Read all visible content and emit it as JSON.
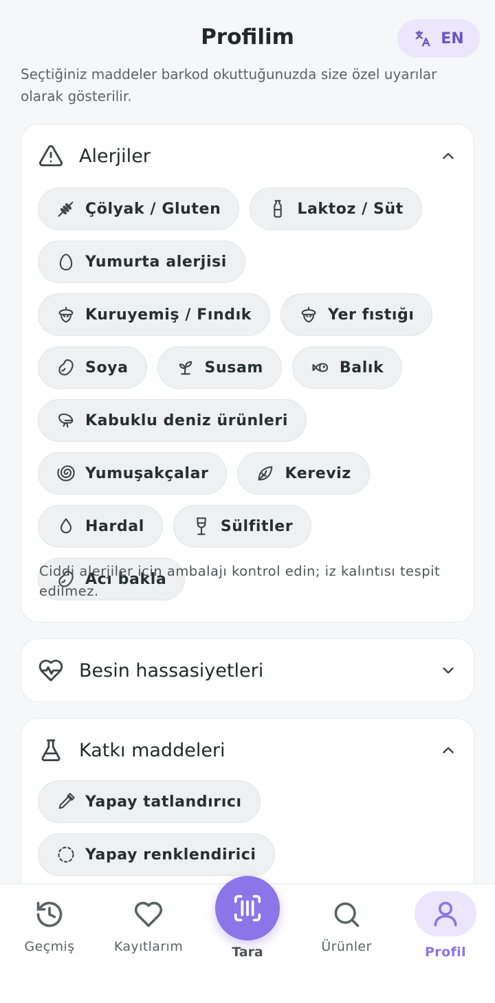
{
  "header": {
    "title": "Profilim",
    "language": "EN"
  },
  "intro_text": "Seçtiğiniz maddeler barkod okuttuğunuzda size özel uyarılar olarak gösterilir.",
  "sections": {
    "allergies": {
      "title": "Alerjiler",
      "expanded": true,
      "chips": [
        {
          "label": "Çölyak / Gluten",
          "icon": "wheat-icon"
        },
        {
          "label": "Laktoz / Süt",
          "icon": "milk-bottle-icon"
        },
        {
          "label": "Yumurta alerjisi",
          "icon": "egg-icon"
        },
        {
          "label": "Kuruyemiş / Fındık",
          "icon": "nut-icon"
        },
        {
          "label": "Yer fıstığı",
          "icon": "nut-icon"
        },
        {
          "label": "Soya",
          "icon": "bean-icon"
        },
        {
          "label": "Susam",
          "icon": "sprout-icon"
        },
        {
          "label": "Balık",
          "icon": "fish-icon"
        },
        {
          "label": "Kabuklu deniz ürünleri",
          "icon": "shrimp-icon"
        },
        {
          "label": "Yumuşakçalar",
          "icon": "shell-icon"
        },
        {
          "label": "Kereviz",
          "icon": "leaf-icon"
        },
        {
          "label": "Hardal",
          "icon": "droplet-icon"
        },
        {
          "label": "Sülfitler",
          "icon": "wine-glass-icon"
        },
        {
          "label": "Acı bakla",
          "icon": "bean-icon"
        }
      ],
      "note": "Ciddi alerjiler için ambalajı kontrol edin; iz kalıntısı tespit edilmez."
    },
    "sensitivities": {
      "title": "Besin hassasiyetleri",
      "expanded": false
    },
    "additives": {
      "title": "Katkı maddeleri",
      "expanded": true,
      "chips": [
        {
          "label": "Yapay tatlandırıcı",
          "icon": "pipette-icon"
        },
        {
          "label": "Yapay renklendirici",
          "icon": "dashed-circle-icon"
        }
      ]
    }
  },
  "bottom_nav": {
    "items": [
      {
        "label": "Geçmiş",
        "icon": "history-icon"
      },
      {
        "label": "Kayıtlarım",
        "icon": "heart-icon"
      },
      {
        "label": "Tara",
        "icon": "scan-barcode-icon"
      },
      {
        "label": "Ürünler",
        "icon": "search-icon"
      },
      {
        "label": "Profil",
        "icon": "user-icon"
      }
    ],
    "active": "Profil"
  },
  "colors": {
    "accent": "#8c74e9",
    "accent_light": "#ebe6fb",
    "background": "#f6f7f9",
    "chip_background": "#eef0f2"
  }
}
